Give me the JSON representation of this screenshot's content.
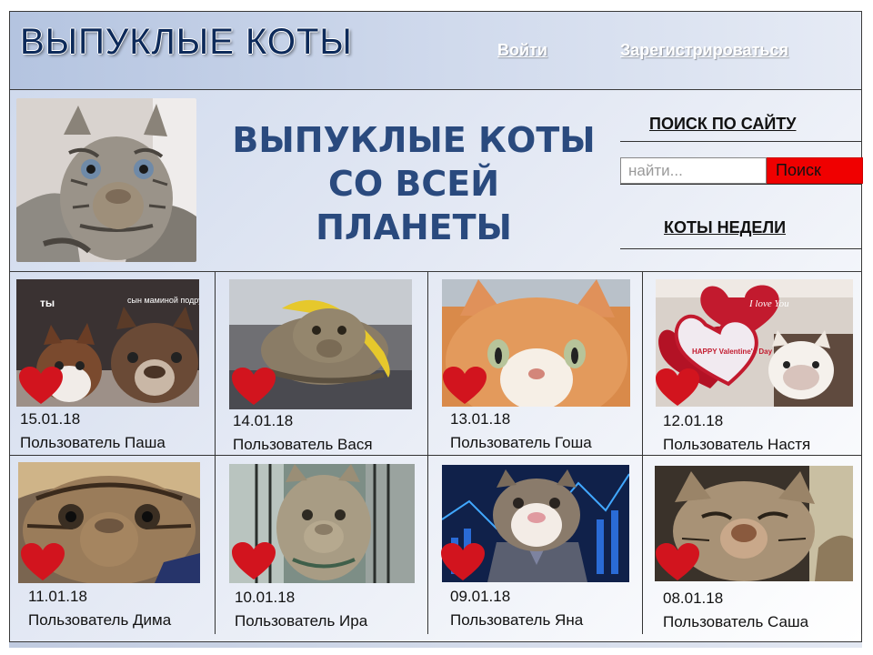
{
  "site": {
    "logo": "ВЫПУКЛЫЕ КОТЫ",
    "nav": {
      "login": "Войти",
      "register": "Зарегистрироваться"
    }
  },
  "hero": {
    "tagline_lines": [
      "ВЫПУКЛЫЕ КОТЫ",
      "СО ВСЕЙ",
      "ПЛАНЕТЫ"
    ]
  },
  "sidebar": {
    "search_title": "ПОИСК ПО САЙТУ",
    "search_placeholder": "найти...",
    "search_button": "Поиск",
    "weekly_title": "КОТЫ НЕДЕЛИ"
  },
  "cards": [
    {
      "date": "15.01.18",
      "user": "Пользователь Паша",
      "caption_left": "ты",
      "caption_right": "сын маминой подруги"
    },
    {
      "date": "14.01.18",
      "user": "Пользователь Вася"
    },
    {
      "date": "13.01.18",
      "user": "Пользователь Гоша"
    },
    {
      "date": "12.01.18",
      "user": "Пользователь Настя",
      "balloon_text_1": "I love You",
      "balloon_text_2": "HAPPY Valentine's Day"
    },
    {
      "date": "11.01.18",
      "user": "Пользователь Дима"
    },
    {
      "date": "10.01.18",
      "user": "Пользователь Ира"
    },
    {
      "date": "09.01.18",
      "user": "Пользователь Яна"
    },
    {
      "date": "08.01.18",
      "user": "Пользователь Саша"
    }
  ],
  "colors": {
    "heart": "#d2141e",
    "search_button": "#f00000",
    "logo": "#0d2a5a",
    "tagline": "#2a4a7e",
    "header_bg": "#c4d1e8"
  },
  "icons": {
    "like": "heart-icon"
  }
}
